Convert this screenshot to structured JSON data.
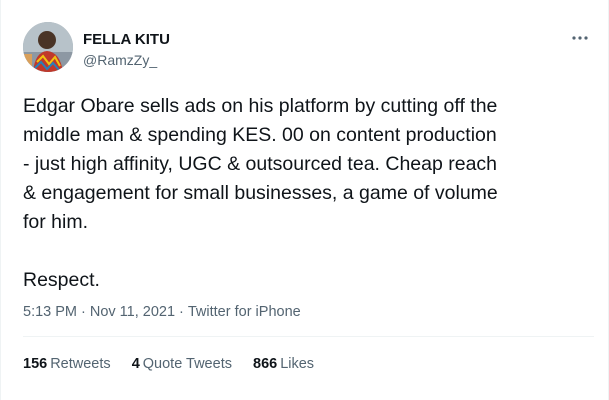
{
  "tweet": {
    "author": {
      "display_name": "FELLA KITU",
      "handle": "@RamzZy_"
    },
    "text": "Edgar Obare sells ads on his platform by cutting off the\nmiddle man & spending KES. 00 on content production\n- just high affinity, UGC & outsourced tea. Cheap reach\n& engagement for small businesses, a game of volume\nfor him.\n\nRespect.",
    "time": "5:13 PM",
    "date": "Nov 11, 2021",
    "source": "Twitter for iPhone",
    "separator": "·"
  },
  "stats": {
    "retweets": {
      "count": "156",
      "label": "Retweets"
    },
    "quote_tweets": {
      "count": "4",
      "label": "Quote Tweets"
    },
    "likes": {
      "count": "866",
      "label": "Likes"
    }
  },
  "icons": {
    "more": "more-horizontal-icon",
    "avatar": "profile-photo"
  },
  "colors": {
    "primary_text": "#0f1419",
    "secondary_text": "#536471",
    "divider": "#eff3f4"
  }
}
